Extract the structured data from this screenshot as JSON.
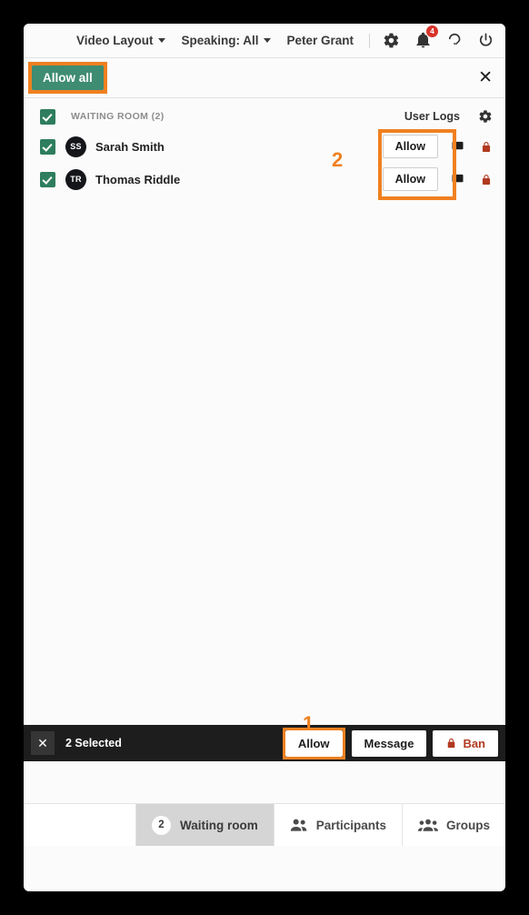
{
  "toolbar": {
    "video_layout": "Video Layout",
    "speaking": "Speaking: All",
    "user_name": "Peter Grant",
    "gear_icon": "gear-icon",
    "bell_icon": "bell-icon",
    "notification_count": "4",
    "help_icon": "question-mark-icon",
    "power_icon": "power-icon"
  },
  "header_bar": {
    "allow_all_label": "Allow all",
    "close_label": "✕"
  },
  "list_header": {
    "section_label": "WAITING ROOM (2)",
    "user_logs_label": "User Logs",
    "settings_icon": "gear-icon"
  },
  "participants": [
    {
      "initials": "SS",
      "name": "Sarah Smith",
      "allow_label": "Allow",
      "chat_icon": "chat-bubble-icon",
      "lock_icon": "lock-icon"
    },
    {
      "initials": "TR",
      "name": "Thomas Riddle",
      "allow_label": "Allow",
      "chat_icon": "chat-bubble-icon",
      "lock_icon": "lock-icon"
    }
  ],
  "selection_bar": {
    "close_label": "✕",
    "count_label": "2 Selected",
    "allow_label": "Allow",
    "message_label": "Message",
    "ban_label": "Ban",
    "ban_icon": "lock-icon"
  },
  "annotations": {
    "marker_one": "1",
    "marker_two": "2"
  },
  "tabs": [
    {
      "label": "Waiting room",
      "badge": "2",
      "icon": "",
      "active": true
    },
    {
      "label": "Participants",
      "badge": "",
      "icon": "people-icon",
      "active": false
    },
    {
      "label": "Groups",
      "badge": "",
      "icon": "group-icon",
      "active": false
    }
  ],
  "colors": {
    "accent_green": "#3e8c72",
    "checkbox_green": "#2e7d5f",
    "highlight_orange": "#f08020",
    "danger_red": "#b03a20",
    "badge_red": "#d8332a",
    "dark_bar": "#1d1d1d"
  }
}
